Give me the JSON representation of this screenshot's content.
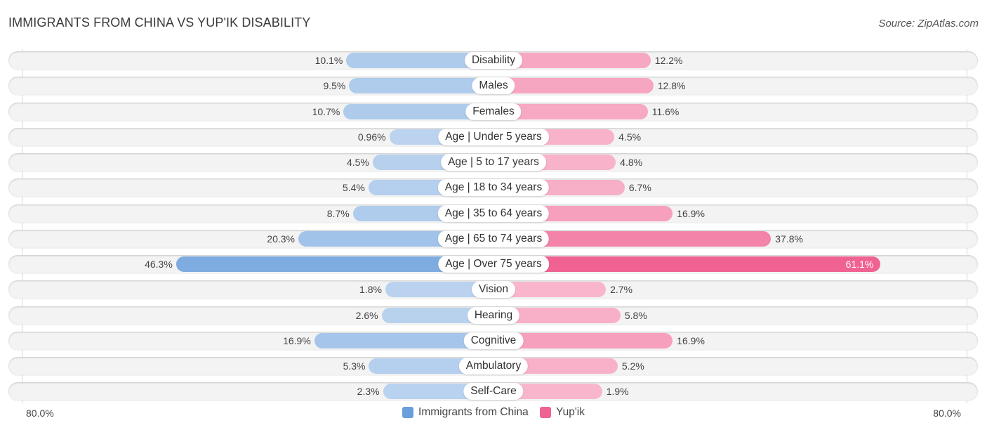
{
  "header": {
    "title": "IMMIGRANTS FROM CHINA VS YUP'IK DISABILITY",
    "source": "Source: ZipAtlas.com"
  },
  "colors": {
    "left": "#6a9fdc",
    "right": "#f06292"
  },
  "chart_data": {
    "type": "bar",
    "orientation": "horizontal-diverging",
    "title": "IMMIGRANTS FROM CHINA VS YUP'IK DISABILITY",
    "xlim": [
      -80,
      80
    ],
    "axis_min_label": "80.0%",
    "axis_max_label": "80.0%",
    "legend_position": "bottom-center",
    "categories": [
      "Disability",
      "Males",
      "Females",
      "Age | Under 5 years",
      "Age | 5 to 17 years",
      "Age | 18 to 34 years",
      "Age | 35 to 64 years",
      "Age | 65 to 74 years",
      "Age | Over 75 years",
      "Vision",
      "Hearing",
      "Cognitive",
      "Ambulatory",
      "Self-Care"
    ],
    "series": [
      {
        "name": "Immigrants from China",
        "side": "left",
        "values": [
          10.1,
          9.5,
          10.7,
          0.96,
          4.5,
          5.4,
          8.7,
          20.3,
          46.3,
          1.8,
          2.6,
          16.9,
          5.3,
          2.3
        ],
        "labels": [
          "10.1%",
          "9.5%",
          "10.7%",
          "0.96%",
          "4.5%",
          "5.4%",
          "8.7%",
          "20.3%",
          "46.3%",
          "1.8%",
          "2.6%",
          "16.9%",
          "5.3%",
          "2.3%"
        ]
      },
      {
        "name": "Yup'ik",
        "side": "right",
        "values": [
          12.2,
          12.8,
          11.6,
          4.5,
          4.8,
          6.7,
          16.9,
          37.8,
          61.1,
          2.7,
          5.8,
          16.9,
          5.2,
          1.9
        ],
        "labels": [
          "12.2%",
          "12.8%",
          "11.6%",
          "4.5%",
          "4.8%",
          "6.7%",
          "16.9%",
          "37.8%",
          "61.1%",
          "2.7%",
          "5.8%",
          "16.9%",
          "5.2%",
          "1.9%"
        ]
      }
    ]
  },
  "legend": {
    "items": [
      {
        "label": "Immigrants from China"
      },
      {
        "label": "Yup'ik"
      }
    ]
  }
}
